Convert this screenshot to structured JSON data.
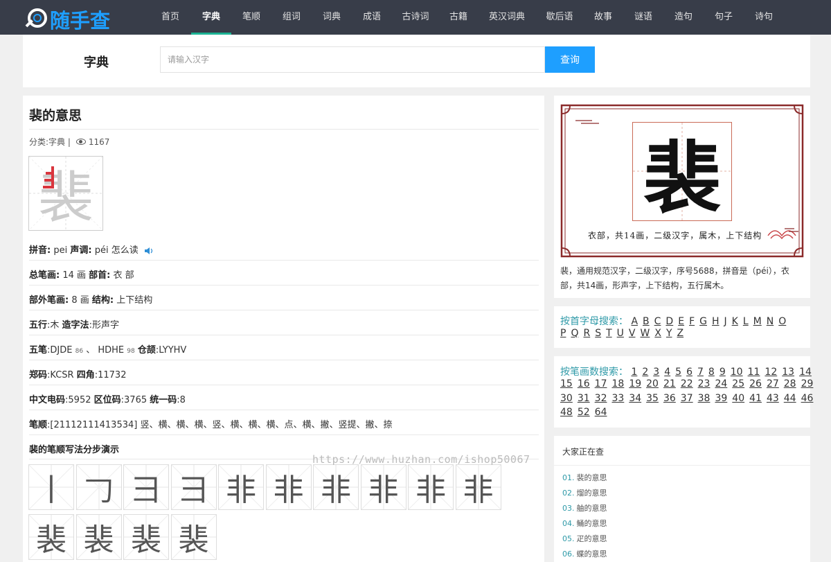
{
  "site": {
    "logo_text": "随手查"
  },
  "nav": {
    "items": [
      {
        "label": "首页",
        "width": 60
      },
      {
        "label": "字典",
        "width": 58,
        "active": true
      },
      {
        "label": "笔顺",
        "width": 58
      },
      {
        "label": "组词",
        "width": 58
      },
      {
        "label": "词典",
        "width": 58
      },
      {
        "label": "成语",
        "width": 58
      },
      {
        "label": "古诗词",
        "width": 68
      },
      {
        "label": "古籍",
        "width": 56
      },
      {
        "label": "英汉词典",
        "width": 84
      },
      {
        "label": "歇后语",
        "width": 68
      },
      {
        "label": "故事",
        "width": 58
      },
      {
        "label": "谜语",
        "width": 58
      },
      {
        "label": "造句",
        "width": 58
      },
      {
        "label": "句子",
        "width": 58
      },
      {
        "label": "诗句",
        "width": 58
      }
    ]
  },
  "search": {
    "label": "字典",
    "placeholder": "请输入汉字",
    "button": "查询"
  },
  "article": {
    "title": "裴的意思",
    "meta_category": "分类:字典 |",
    "views": "1167",
    "char": "裴",
    "rows": {
      "pinyin": {
        "k1": "拼音:",
        "v1": "pei",
        "k2": "声调:",
        "v2": "péi 怎么读"
      },
      "strokes": {
        "k1": "总笔画:",
        "v1": "14 画",
        "k2": "部首:",
        "v2": "衣 部"
      },
      "outer": {
        "k1": "部外笔画:",
        "v1": "8 画",
        "k2": "结构:",
        "v2": "上下结构"
      },
      "wuxing": {
        "k1": "五行",
        "v1": ":木",
        "k2": "造字法",
        "v2": ":形声字"
      },
      "wubi": {
        "k1": "五笔",
        "v1": ":DJDE",
        "s1": "86",
        "v1b": "、 HDHE",
        "s2": "98",
        "k2": "仓颉",
        "v2": ":LYYHV"
      },
      "zheng": {
        "k1": "郑码",
        "v1": ":KCSR",
        "k2": "四角",
        "v2": ":11732"
      },
      "code": {
        "k1": "中文电码",
        "v1": ":5952",
        "k2": "区位码",
        "v2": ":3765",
        "k3": "统一码",
        "v3": ":8"
      },
      "order": {
        "k1": "笔顺",
        "v1": ":[21112111413534] 竖、横、横、横、竖、横、横、横、点、横、撇、竖提、撇、捺"
      }
    },
    "stroke_title": "裴的笔顺写法分步演示",
    "stroke_steps": [
      "丨",
      "𠃌",
      "彐",
      "彐",
      "非",
      "非",
      "非",
      "非",
      "非",
      "非",
      "裴",
      "裴",
      "裴",
      "裴"
    ],
    "watermark": "https://www.huzhan.com/ishop50067"
  },
  "side": {
    "frame_char": "裴",
    "frame_caption": "衣部，共14画，二级汉字，属木，上下结构",
    "description": "裴，通用规范汉字，二级汉字，序号5688，拼音是（péi），衣部，共14画，形声字，上下结构，五行属木。",
    "letter_index": {
      "title": "按首字母搜索：",
      "row1": [
        "A",
        "B",
        "C",
        "D",
        "E",
        "F",
        "G",
        "H",
        "J",
        "K",
        "L",
        "M",
        "N",
        "O"
      ],
      "row2": [
        "P",
        "Q",
        "R",
        "S",
        "T",
        "U",
        "V",
        "W",
        "X",
        "Y",
        "Z"
      ]
    },
    "stroke_index": {
      "title": "按笔画数搜索：",
      "row1": [
        "1",
        "2",
        "3",
        "4",
        "5",
        "6",
        "7",
        "8",
        "9",
        "10",
        "11",
        "12",
        "13",
        "14"
      ],
      "row2": [
        "15",
        "16",
        "17",
        "18",
        "19",
        "20",
        "21",
        "22",
        "23",
        "24",
        "25",
        "26",
        "27",
        "28",
        "29"
      ],
      "row3": [
        "30",
        "31",
        "32",
        "33",
        "34",
        "35",
        "36",
        "37",
        "38",
        "39",
        "40",
        "41",
        "43",
        "44",
        "46"
      ],
      "row4": [
        "48",
        "52",
        "64"
      ]
    },
    "hot": {
      "title": "大家正在查",
      "items": [
        {
          "num": "01.",
          "text": "裴的意思"
        },
        {
          "num": "02.",
          "text": "熘的意思"
        },
        {
          "num": "03.",
          "text": "舳的意思"
        },
        {
          "num": "04.",
          "text": "鲬的意思"
        },
        {
          "num": "05.",
          "text": "疋的意思"
        },
        {
          "num": "06.",
          "text": "蝶的意思"
        }
      ]
    }
  }
}
